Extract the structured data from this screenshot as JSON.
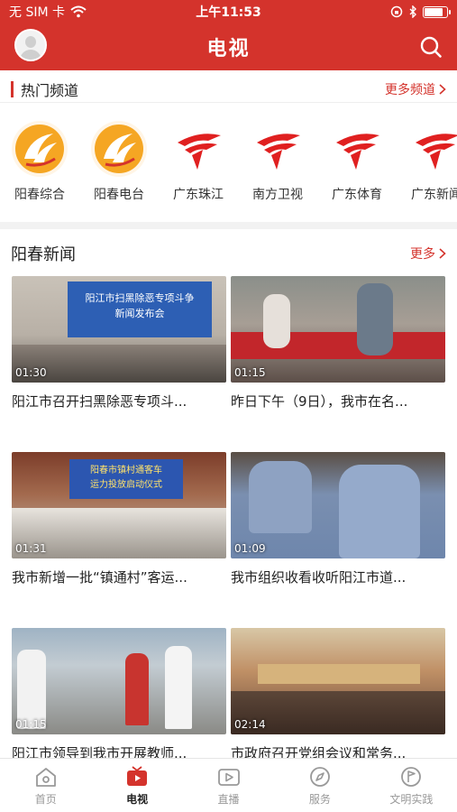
{
  "status_bar": {
    "carrier": "无 SIM 卡",
    "time": "上午11:53",
    "battery_level": 0.85
  },
  "header": {
    "title": "电视"
  },
  "hot_channels": {
    "title": "热门频道",
    "more_label": "更多频道",
    "items": [
      {
        "name": "阳春综合",
        "icon": "yangchun-logo-icon"
      },
      {
        "name": "阳春电台",
        "icon": "yangchun-logo-icon"
      },
      {
        "name": "广东珠江",
        "icon": "guangdong-tv-logo-icon"
      },
      {
        "name": "南方卫视",
        "icon": "guangdong-tv-logo-icon"
      },
      {
        "name": "广东体育",
        "icon": "guangdong-tv-logo-icon"
      },
      {
        "name": "广东新闻",
        "icon": "guangdong-tv-logo-icon"
      }
    ]
  },
  "news": {
    "title": "阳春新闻",
    "more_label": "更多",
    "items": [
      {
        "title": "阳江市召开扫黑除恶专项斗...",
        "duration": "01:30",
        "thumb_caption": "阳江市扫黑除恶专项斗争\n新闻发布会"
      },
      {
        "title": "昨日下午（9日），我市在名...",
        "duration": "01:15"
      },
      {
        "title": "我市新增一批“镇通村”客运...",
        "duration": "01:31",
        "thumb_caption": "阳春市镇村通客车\n运力投放启动仪式"
      },
      {
        "title": "我市组织收看收听阳江市道...",
        "duration": "01:09"
      },
      {
        "title": "阳江市领导到我市开展教师...",
        "duration": "01:15"
      },
      {
        "title": "市政府召开党组会议和常务...",
        "duration": "02:14"
      }
    ]
  },
  "tabbar": {
    "items": [
      {
        "label": "首页",
        "active": false
      },
      {
        "label": "电视",
        "active": true
      },
      {
        "label": "直播",
        "active": false
      },
      {
        "label": "服务",
        "active": false
      },
      {
        "label": "文明实践",
        "active": false
      }
    ]
  },
  "colors": {
    "brand_red": "#d4332c",
    "inactive_gray": "#999999"
  }
}
